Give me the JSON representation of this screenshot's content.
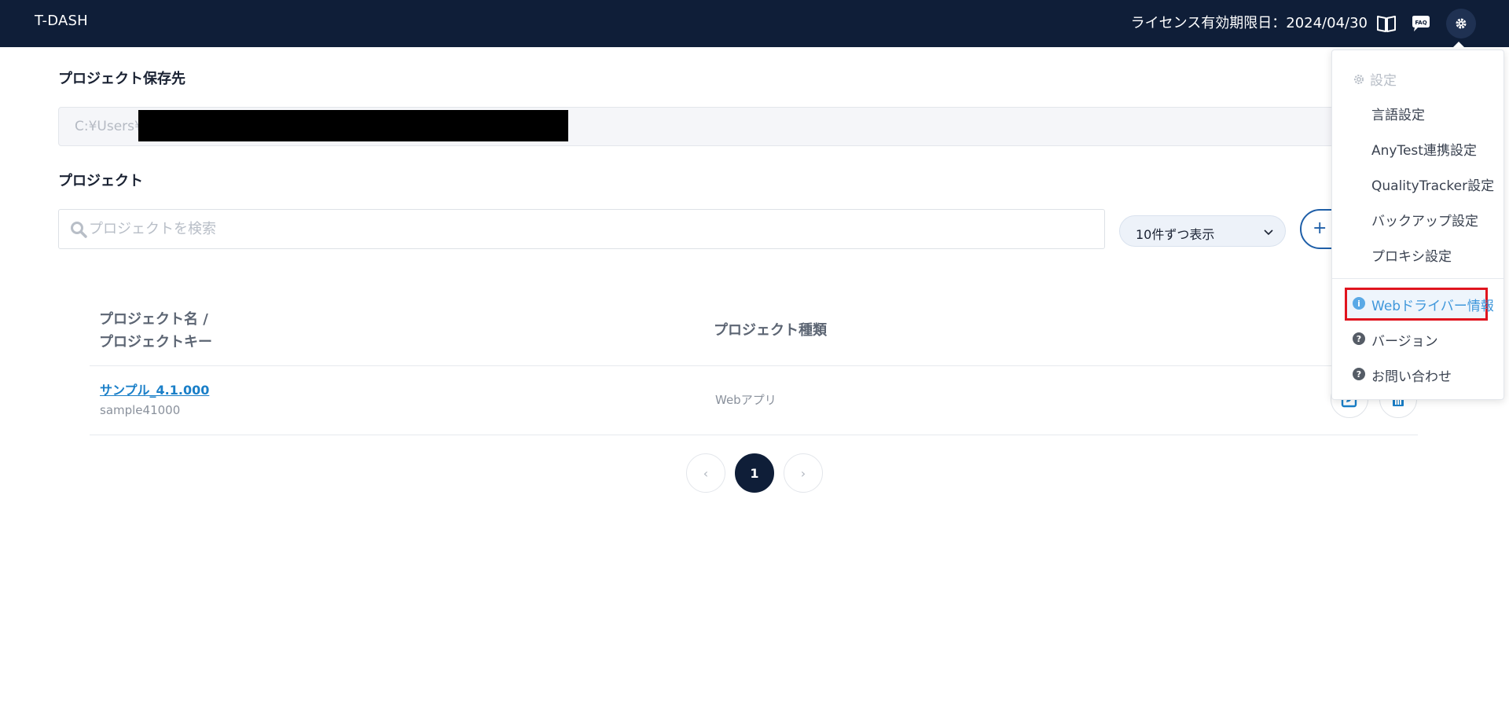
{
  "header": {
    "brand": "T-DASH",
    "license": "ライセンス有効期限日：2024/04/30",
    "icons": [
      "book-icon",
      "faq-icon",
      "gear-icon"
    ],
    "faq_label": "FAQ"
  },
  "storage": {
    "title": "プロジェクト保存先",
    "path": "C:¥Users¥"
  },
  "projects": {
    "title": "プロジェクト",
    "search_placeholder": "プロジェクトを検索",
    "per_page": "10件ずつ表示",
    "new_button": "+"
  },
  "table": {
    "col1_line1": "プロジェクト名 /",
    "col1_line2": "プロジェクトキー",
    "col2": "プロジェクト種類",
    "rows": [
      {
        "name": "サンプル_4.1.000",
        "key": "sample41000",
        "type": "Webアプリ"
      }
    ]
  },
  "pagination": {
    "prev": "‹",
    "current": "1",
    "next": "›"
  },
  "settings_menu": {
    "header": "設定",
    "items": [
      "言語設定",
      "AnyTest連携設定",
      "QualityTracker設定",
      "バックアップ設定",
      "プロキシ設定"
    ],
    "info_items": [
      "Webドライバー情報",
      "バージョン",
      "お問い合わせ"
    ]
  },
  "colors": {
    "header_bg": "#0f1e38",
    "accent": "#1a7fc8",
    "highlight_border": "#e0141e"
  }
}
